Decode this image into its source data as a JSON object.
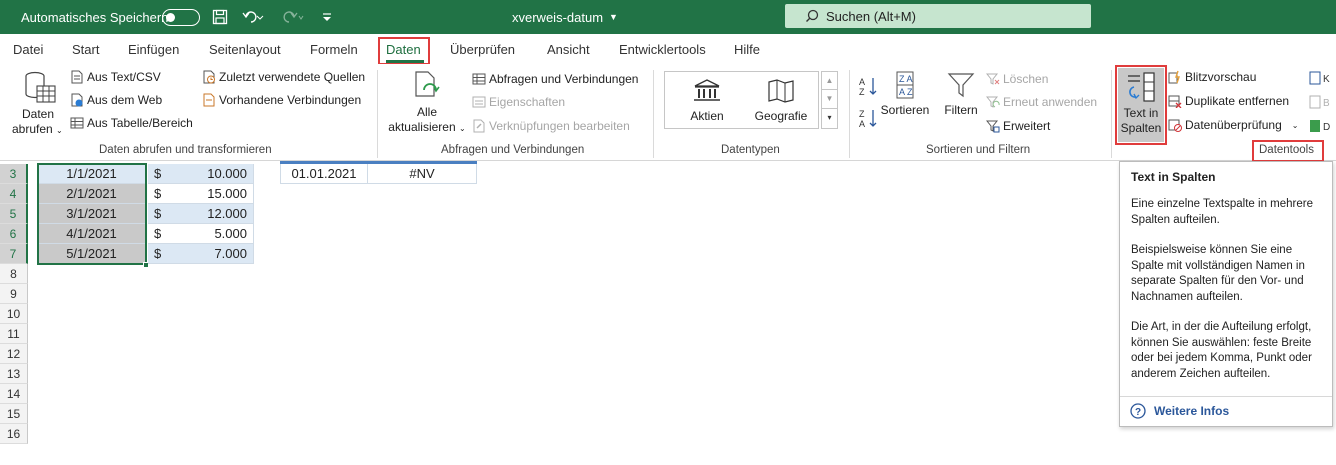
{
  "titlebar": {
    "autosave_label": "Automatisches Speichern",
    "doc_title": "xverweis-datum",
    "search_placeholder": "Suchen (Alt+M)"
  },
  "tabs": [
    "Datei",
    "Start",
    "Einfügen",
    "Seitenlayout",
    "Formeln",
    "Daten",
    "Überprüfen",
    "Ansicht",
    "Entwicklertools",
    "Hilfe"
  ],
  "active_tab": "Daten",
  "ribbon": {
    "get_data": {
      "line1": "Daten",
      "line2": "abrufen"
    },
    "from_text": "Aus Text/CSV",
    "from_web": "Aus dem Web",
    "from_table": "Aus Tabelle/Bereich",
    "recent_sources": "Zuletzt verwendete Quellen",
    "existing_connections": "Vorhandene Verbindungen",
    "group1": "Daten abrufen und transformieren",
    "refresh": {
      "line1": "Alle",
      "line2": "aktualisieren"
    },
    "queries": "Abfragen und Verbindungen",
    "properties": "Eigenschaften",
    "edit_links": "Verknüpfungen bearbeiten",
    "group2": "Abfragen und Verbindungen",
    "stocks": "Aktien",
    "geography": "Geografie",
    "group3": "Datentypen",
    "sort": "Sortieren",
    "filter": "Filtern",
    "clear": "Löschen",
    "reapply": "Erneut anwenden",
    "advanced": "Erweitert",
    "group4": "Sortieren und Filtern",
    "text_to_columns": {
      "line1": "Text in",
      "line2": "Spalten"
    },
    "flash_fill": "Blitzvorschau",
    "remove_duplicates": "Duplikate entfernen",
    "data_validation": "Datenüberprüfung",
    "group5": "Datentools"
  },
  "sheet": {
    "rows": [
      {
        "num": "3",
        "date": "1/1/2021",
        "cur": "$",
        "amount": "10.000"
      },
      {
        "num": "4",
        "date": "2/1/2021",
        "cur": "$",
        "amount": "15.000"
      },
      {
        "num": "5",
        "date": "3/1/2021",
        "cur": "$",
        "amount": "12.000"
      },
      {
        "num": "6",
        "date": "4/1/2021",
        "cur": "$",
        "amount": "5.000"
      },
      {
        "num": "7",
        "date": "5/1/2021",
        "cur": "$",
        "amount": "7.000"
      }
    ],
    "empty_rows": [
      "8",
      "9",
      "10",
      "11",
      "12",
      "13",
      "14",
      "15",
      "16"
    ],
    "lookup_value": "01.01.2021",
    "lookup_result": "#NV"
  },
  "tooltip": {
    "title": "Text in Spalten",
    "p1": "Eine einzelne Textspalte in mehrere Spalten aufteilen.",
    "p2": "Beispielsweise können Sie eine Spalte mit vollständigen Namen in separate Spalten für den Vor- und Nachnamen aufteilen.",
    "p3": "Die Art, in der die Aufteilung erfolgt, können Sie auswählen: feste Breite oder bei jedem Komma, Punkt oder anderem Zeichen aufteilen.",
    "more": "Weitere Infos"
  },
  "colors": {
    "excel_green": "#217346",
    "highlight": "#e03c3c",
    "link": "#2b579a"
  }
}
